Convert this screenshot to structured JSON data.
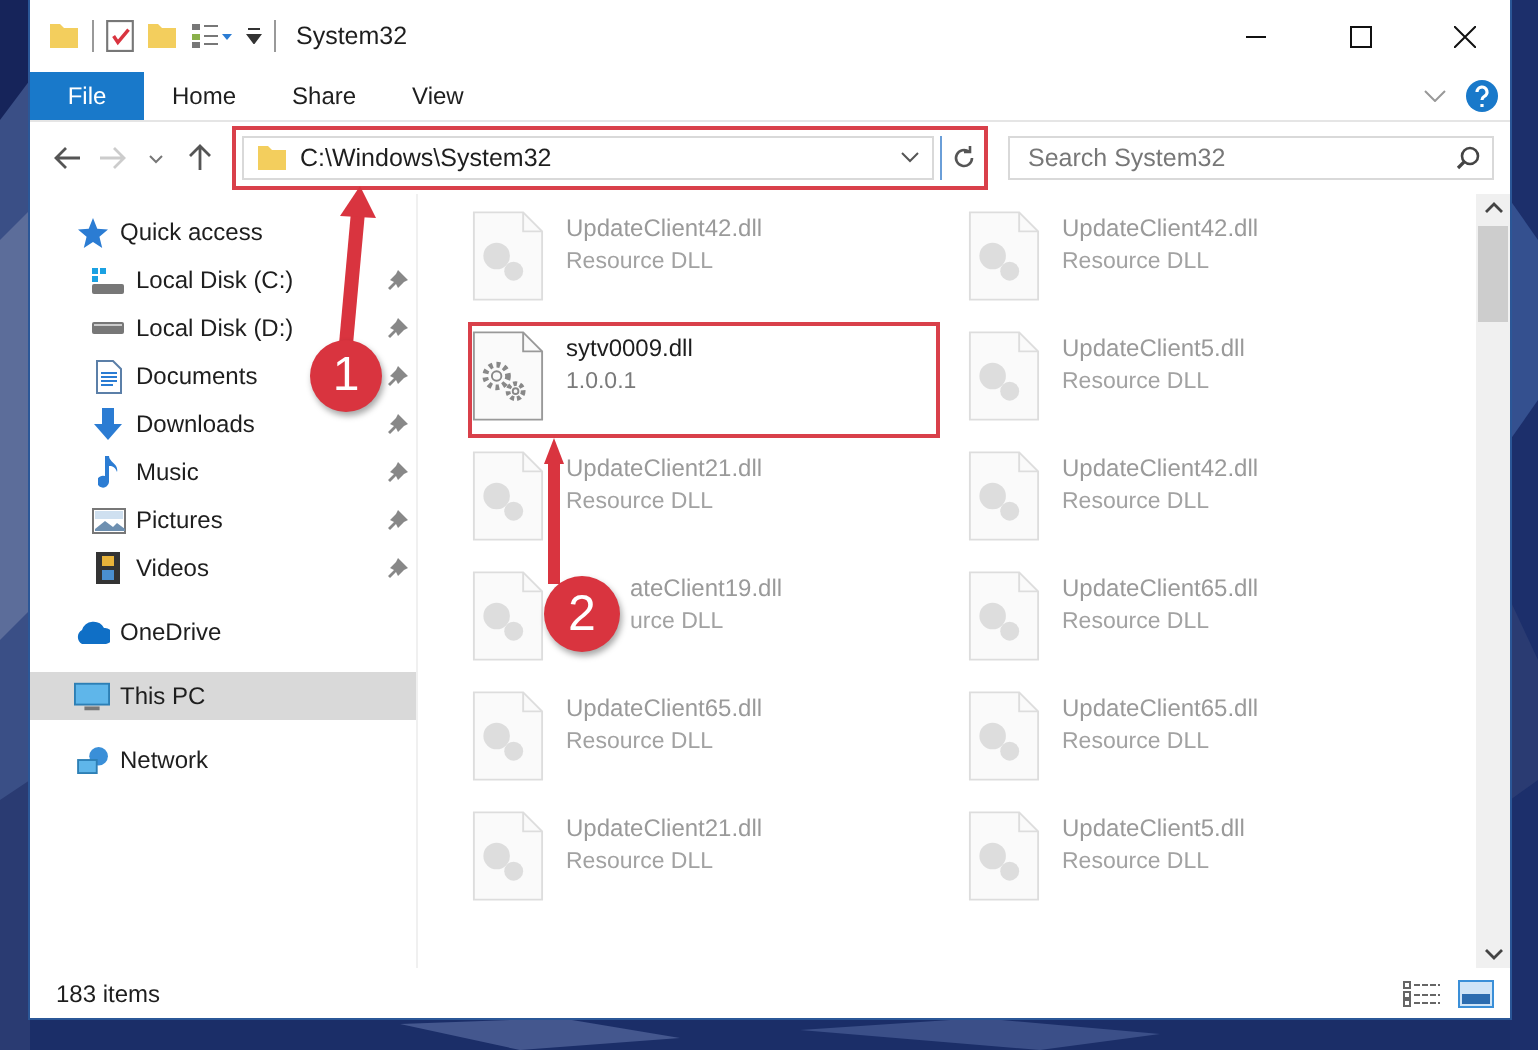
{
  "window": {
    "title": "System32"
  },
  "ribbon": {
    "file_tab": "File",
    "tabs": [
      "Home",
      "Share",
      "View"
    ]
  },
  "address": {
    "path": "C:\\Windows\\System32",
    "highlighted": true
  },
  "search": {
    "placeholder": "Search System32"
  },
  "nav": [
    {
      "label": "Quick access",
      "kind": "star",
      "selected": false,
      "children": [
        {
          "label": "Local Disk (C:)",
          "kind": "drive-c",
          "pinned": true
        },
        {
          "label": "Local Disk (D:)",
          "kind": "drive",
          "pinned": true
        },
        {
          "label": "Documents",
          "kind": "document",
          "pinned": true
        },
        {
          "label": "Downloads",
          "kind": "download",
          "pinned": true
        },
        {
          "label": "Music",
          "kind": "music",
          "pinned": true
        },
        {
          "label": "Pictures",
          "kind": "pictures",
          "pinned": true
        },
        {
          "label": "Videos",
          "kind": "videos",
          "pinned": true
        }
      ]
    },
    {
      "label": "OneDrive",
      "kind": "cloud",
      "selected": false
    },
    {
      "label": "This PC",
      "kind": "pc",
      "selected": true
    },
    {
      "label": "Network",
      "kind": "network",
      "selected": false
    }
  ],
  "files": [
    {
      "name": "UpdateClient42.dll",
      "detail": "Resource DLL",
      "faded": true,
      "highlighted": false,
      "covered": false
    },
    {
      "name": "UpdateClient42.dll",
      "detail": "Resource DLL",
      "faded": true,
      "highlighted": false,
      "covered": false
    },
    {
      "name": "sytv0009.dll",
      "detail": "1.0.0.1",
      "faded": false,
      "highlighted": true,
      "covered": false
    },
    {
      "name": "UpdateClient5.dll",
      "detail": "Resource DLL",
      "faded": true,
      "highlighted": false,
      "covered": false
    },
    {
      "name": "UpdateClient21.dll",
      "detail": "Resource DLL",
      "faded": true,
      "highlighted": false,
      "covered": false
    },
    {
      "name": "UpdateClient42.dll",
      "detail": "Resource DLL",
      "faded": true,
      "highlighted": false,
      "covered": false
    },
    {
      "name": "ateClient19.dll",
      "detail": "urce DLL",
      "faded": true,
      "highlighted": false,
      "covered": true
    },
    {
      "name": "UpdateClient65.dll",
      "detail": "Resource DLL",
      "faded": true,
      "highlighted": false,
      "covered": false
    },
    {
      "name": "UpdateClient65.dll",
      "detail": "Resource DLL",
      "faded": true,
      "highlighted": false,
      "covered": false
    },
    {
      "name": "UpdateClient65.dll",
      "detail": "Resource DLL",
      "faded": true,
      "highlighted": false,
      "covered": false
    },
    {
      "name": "UpdateClient21.dll",
      "detail": "Resource DLL",
      "faded": true,
      "highlighted": false,
      "covered": false
    },
    {
      "name": "UpdateClient5.dll",
      "detail": "Resource DLL",
      "faded": true,
      "highlighted": false,
      "covered": false
    }
  ],
  "annotations": [
    {
      "number": "1"
    },
    {
      "number": "2"
    }
  ],
  "status_bar": {
    "item_count": "183 items"
  }
}
